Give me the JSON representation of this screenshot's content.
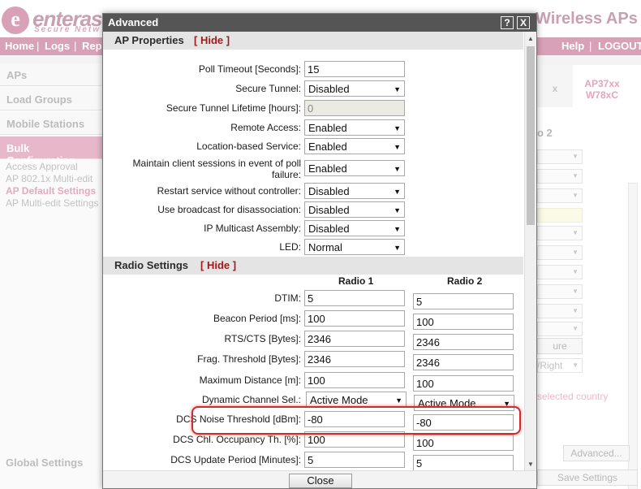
{
  "app": {
    "logo_letter": "e",
    "logo_text": "enteras",
    "logo_tagline": "Secure Netw",
    "title_fragment": "Wireless APs",
    "nav": {
      "home": "Home",
      "logs": "Logs",
      "reports_partial": "Rep",
      "help": "Help",
      "logout": "LOGOUT"
    },
    "sidebar": {
      "items": [
        "APs",
        "Load Groups",
        "Mobile Stations",
        "Bulk Configuration"
      ],
      "sub_items": [
        "Access Approval",
        "AP 802.1x Multi-edit",
        "AP Default Settings",
        "AP Multi-edit Settings"
      ],
      "global_settings": "Global Settings"
    },
    "right_panel": {
      "tab_partial": "x",
      "tab_active": "AP37xx W78xC",
      "radio_label": "o 2",
      "btn_partial": "ure",
      "select_partial": "/Right",
      "pink_text": "selected country",
      "advanced_button": "Advanced...",
      "save_button": "Save Settings"
    }
  },
  "dialog": {
    "title": "Advanced",
    "help_btn": "?",
    "close_btn": "X",
    "footer_close": "Close",
    "ap_properties": {
      "title": "AP Properties",
      "hide": "[ Hide ]",
      "poll_timeout": {
        "label": "Poll Timeout [Seconds]:",
        "value": "15"
      },
      "secure_tunnel": {
        "label": "Secure Tunnel:",
        "value": "Disabled"
      },
      "secure_tunnel_lifetime": {
        "label": "Secure Tunnel Lifetime [hours]:",
        "value": "0"
      },
      "remote_access": {
        "label": "Remote Access:",
        "value": "Enabled"
      },
      "location_service": {
        "label": "Location-based Service:",
        "value": "Enabled"
      },
      "maintain_sessions": {
        "label_line1": "Maintain client sessions in event of poll",
        "label_line2": "failure:",
        "value": "Enabled"
      },
      "restart_service": {
        "label": "Restart service without controller:",
        "value": "Disabled"
      },
      "broadcast_disassoc": {
        "label": "Use broadcast for disassociation:",
        "value": "Disabled"
      },
      "ip_multicast": {
        "label": "IP Multicast Assembly:",
        "value": "Disabled"
      },
      "led": {
        "label": "LED:",
        "value": "Normal"
      }
    },
    "radio_settings": {
      "title": "Radio Settings",
      "hide": "[ Hide ]",
      "radio1_header": "Radio 1",
      "radio2_header": "Radio 2",
      "dtim": {
        "label": "DTIM:",
        "r1": "5",
        "r2": "5"
      },
      "beacon_period": {
        "label": "Beacon Period [ms]:",
        "r1": "100",
        "r2": "100"
      },
      "rts_cts": {
        "label": "RTS/CTS [Bytes]:",
        "r1": "2346",
        "r2": "2346"
      },
      "frag_threshold": {
        "label": "Frag. Threshold [Bytes]:",
        "r1": "2346",
        "r2": "2346"
      },
      "max_distance": {
        "label": "Maximum Distance [m]:",
        "r1": "100",
        "r2": "100"
      },
      "dynamic_channel": {
        "label": "Dynamic Channel Sel.:",
        "r1": "Active Mode",
        "r2": "Active Mode"
      },
      "dcs_noise": {
        "label": "DCS Noise Threshold [dBm]:",
        "r1": "-80",
        "r2": "-80"
      },
      "dcs_occupancy": {
        "label": "DCS Chl. Occupancy Th. [%]:",
        "r1": "100",
        "r2": "100"
      },
      "dcs_update": {
        "label": "DCS Update Period [Minutes]:",
        "r1": "5",
        "r2": "5"
      }
    }
  },
  "colors": {
    "brand_pink": "#d9a1b7",
    "titlebar": "#555555",
    "hide_link": "#a11b1b",
    "highlight": "#d42a2a"
  }
}
